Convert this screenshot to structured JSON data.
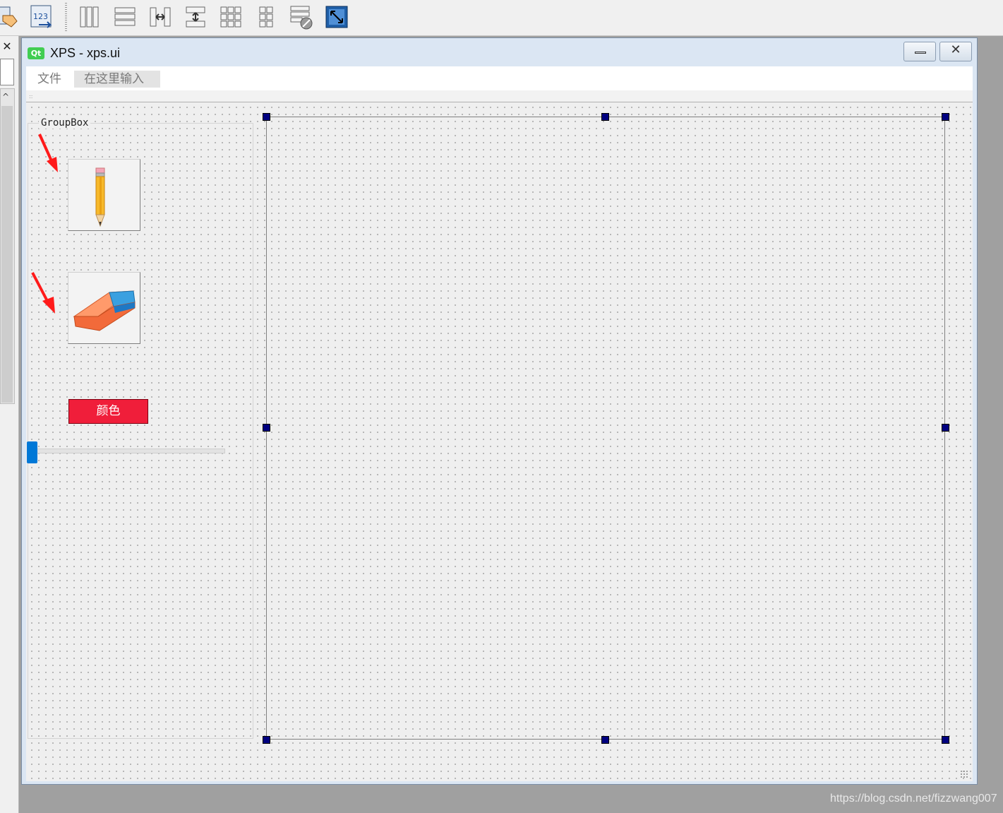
{
  "window": {
    "logo_text": "Qt",
    "title": "XPS - xps.ui",
    "minimize_label": "",
    "close_label": "✕"
  },
  "menubar": {
    "file": "文件",
    "type_here": "在这里输入"
  },
  "groupbox": {
    "title": "GroupBox"
  },
  "buttons": {
    "pencil_icon": "pencil-icon",
    "eraser_icon": "eraser-icon",
    "color_label": "颜色"
  },
  "slider": {
    "value_fraction": 0.0
  },
  "dock": {
    "close_label": "✕",
    "scroll_up": "^"
  },
  "watermark": "https://blog.csdn.net/fizzwang007",
  "colors": {
    "accent_blue": "#0078d7",
    "color_button": "#f01e3a",
    "selection_handle": "#000080",
    "annotation_arrow": "#ff1a1a",
    "qt_green": "#41cd52"
  }
}
